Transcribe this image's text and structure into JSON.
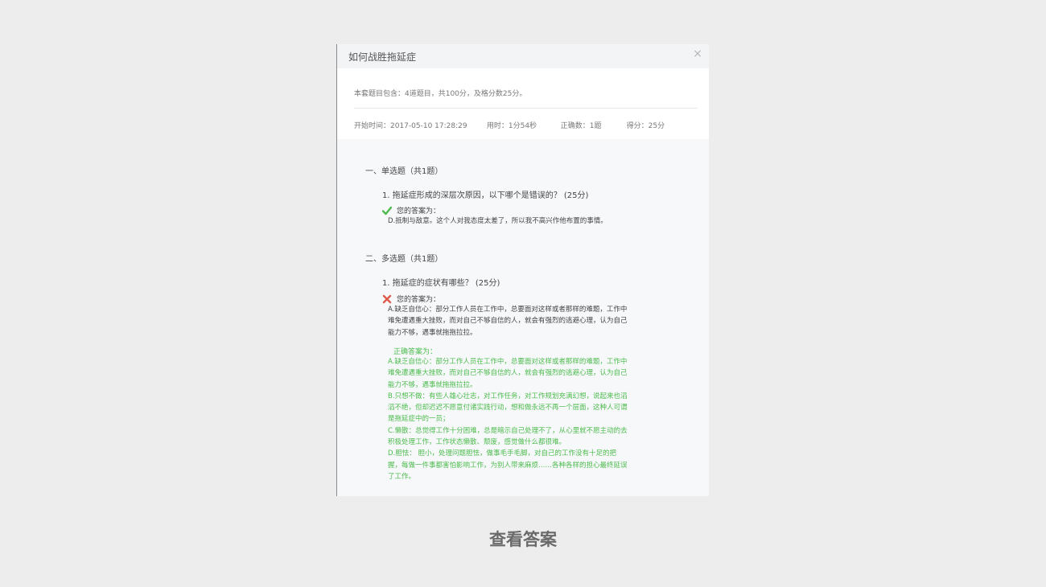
{
  "dialog": {
    "title": "如何战胜拖延症",
    "close": "×"
  },
  "info": {
    "summary": "本套题目包含：4道题目，共100分，及格分数25分。",
    "start_time": "开始时间：2017-05-10 17:28:29",
    "duration": "用时：1分54秒",
    "correct_count": "正确数：1题",
    "score": "得分：25分"
  },
  "sections": [
    {
      "title": "一、单选题（共1题）",
      "question": "1.  拖延症形成的深层次原因，以下哪个是错误的？   (25分)",
      "answer_label": "您的答案为：",
      "answer_status": "correct",
      "answer_text": "D.抵制与敌意。这个人对我态度太差了，所以我不高兴作他布置的事情。"
    },
    {
      "title": "二、多选题（共1题）",
      "question": "1.  拖延症的症状有哪些？   (25分)",
      "answer_label": "您的答案为：",
      "answer_status": "wrong",
      "answer_text": "A.缺乏自信心：部分工作人员在工作中，总要面对这样或者那样的难题，工作中难免遭遇重大挫败，而对自己不够自信的人，就会有强烈的逃避心理，认为自己能力不够，遇事就拖拖拉拉。",
      "correct_label": "正确答案为：",
      "correct_text": [
        "A.缺乏自信心：部分工作人员在工作中，总要面对这样或者那样的难题，工作中难免遭遇重大挫败，而对自己不够自信的人，就会有强烈的逃避心理，认为自己能力不够，遇事就拖拖拉拉。",
        "B.只想不做：有些人雄心壮志，对工作任务，对工作规划充满幻想，说起来也滔滔不绝，但却迟迟不愿意付诸实践行动，想和做永远不再一个层面，这种人可谓是拖延症中的一员；",
        "C.懒散：总觉得工作十分困难，总是暗示自己处理不了，从心里就不愿主动的去积极处理工作，工作状态懒散、颓废，感觉做什么都很难。",
        "D.胆怯： 胆小，处理问题胆怯，做事毛手毛脚，对自己的工作没有十足的把握，每做一件事都害怕影响工作，为别人带来麻烦……各种各样的担心最终延误了工作。"
      ]
    }
  ],
  "footer": {
    "view_answer": "查看答案"
  },
  "colors": {
    "correct_green": "#4dbb4d",
    "wrong_red": "#e05a4b",
    "page_bg": "#ededed"
  },
  "icons": {
    "correct": "check-icon",
    "wrong": "cross-icon"
  }
}
